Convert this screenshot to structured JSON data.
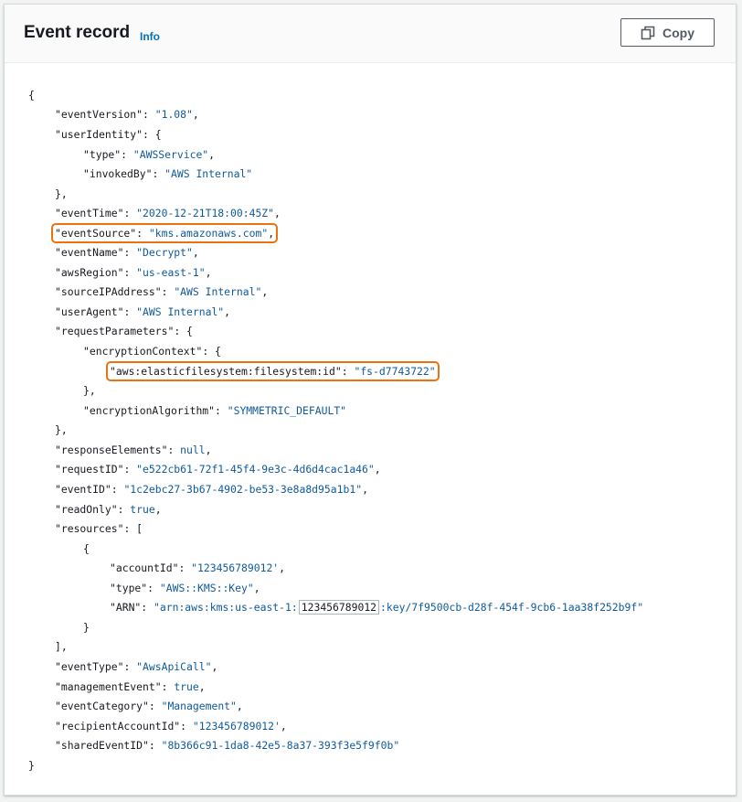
{
  "header": {
    "title": "Event record",
    "info_link": "Info",
    "copy_label": "Copy"
  },
  "colors": {
    "string": "#0f5a9c",
    "highlight": "#ec7211",
    "link": "#0073bb"
  },
  "icons": {
    "copy": "copy-icon"
  },
  "code": {
    "open_brace": "{",
    "eventVersion_key": "\"eventVersion\"",
    "eventVersion_val": "\"1.08\"",
    "userIdentity_key": "\"userIdentity\"",
    "type_key": "\"type\"",
    "type_val": "\"AWSService\"",
    "invokedBy_key": "\"invokedBy\"",
    "invokedBy_val": "\"AWS Internal\"",
    "close_obj_comma": "},",
    "eventTime_key": "\"eventTime\"",
    "eventTime_val": "\"2020-12-21T18:00:45Z\"",
    "eventSource_key": "\"eventSource\"",
    "eventSource_val": "\"kms.amazonaws.com\"",
    "eventName_key": "\"eventName\"",
    "eventName_val": "\"Decrypt\"",
    "awsRegion_key": "\"awsRegion\"",
    "awsRegion_val": "\"us-east-1\"",
    "sourceIPAddress_key": "\"sourceIPAddress\"",
    "sourceIPAddress_val": "\"AWS Internal\"",
    "userAgent_key": "\"userAgent\"",
    "userAgent_val": "\"AWS Internal\"",
    "requestParameters_key": "\"requestParameters\"",
    "encryptionContext_key": "\"encryptionContext\"",
    "efs_key": "\"aws:elasticfilesystem:filesystem:id\"",
    "efs_val": "\"fs-d7743722\"",
    "encryptionAlgorithm_key": "\"encryptionAlgorithm\"",
    "encryptionAlgorithm_val": "\"SYMMETRIC_DEFAULT\"",
    "responseElements_key": "\"responseElements\"",
    "responseElements_val": "null",
    "requestID_key": "\"requestID\"",
    "requestID_val": "\"e522cb61-72f1-45f4-9e3c-4d6d4cac1a46\"",
    "eventID_key": "\"eventID\"",
    "eventID_val": "\"1c2ebc27-3b67-4902-be53-3e8a8d95a1b1\"",
    "readOnly_key": "\"readOnly\"",
    "readOnly_val": "true",
    "resources_key": "\"resources\"",
    "open_bracket": "[",
    "open_obj": "{",
    "accountId_key": "\"accountId\"",
    "accountId_val": "\"123456789012'",
    "res_type_key": "\"type\"",
    "res_type_val": "\"AWS::KMS::Key\"",
    "arn_key": "\"ARN\"",
    "arn_val_prefix": "\"arn:aws:kms:us-east-1:",
    "arn_val_account": "123456789012",
    "arn_val_suffix": ":key/7f9500cb-d28f-454f-9cb6-1aa38f252b9f\"",
    "close_obj": "}",
    "close_bracket_comma": "],",
    "eventType_key": "\"eventType\"",
    "eventType_val": "\"AwsApiCall\"",
    "managementEvent_key": "\"managementEvent\"",
    "managementEvent_val": "true",
    "eventCategory_key": "\"eventCategory\"",
    "eventCategory_val": "\"Management\"",
    "recipientAccountId_key": "\"recipientAccountId\"",
    "recipientAccountId_val": "\"123456789012'",
    "sharedEventID_key": "\"sharedEventID\"",
    "sharedEventID_val": "\"8b366c91-1da8-42e5-8a37-393f3e5f9f0b\"",
    "close_brace": "}"
  }
}
